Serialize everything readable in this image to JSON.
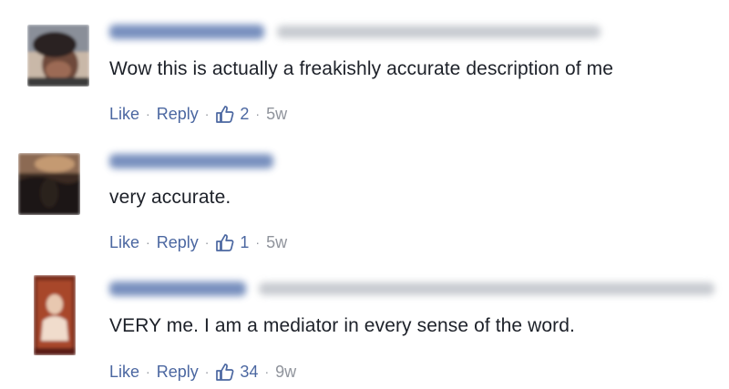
{
  "comments": [
    {
      "text": "Wow this is actually a freakishly accurate description of me",
      "like_label": "Like",
      "reply_label": "Reply",
      "likes": "2",
      "time": "5w",
      "separator": "·"
    },
    {
      "text": "very accurate.",
      "like_label": "Like",
      "reply_label": "Reply",
      "likes": "1",
      "time": "5w",
      "separator": "·"
    },
    {
      "text": "VERY me. I am a mediator in every sense of the word.",
      "like_label": "Like",
      "reply_label": "Reply",
      "likes": "34",
      "time": "9w",
      "separator": "·"
    }
  ],
  "colors": {
    "link": "#4b67a1",
    "text": "#1d2129",
    "meta": "#90949c"
  },
  "icons": {
    "like": "thumbs-up-icon"
  }
}
